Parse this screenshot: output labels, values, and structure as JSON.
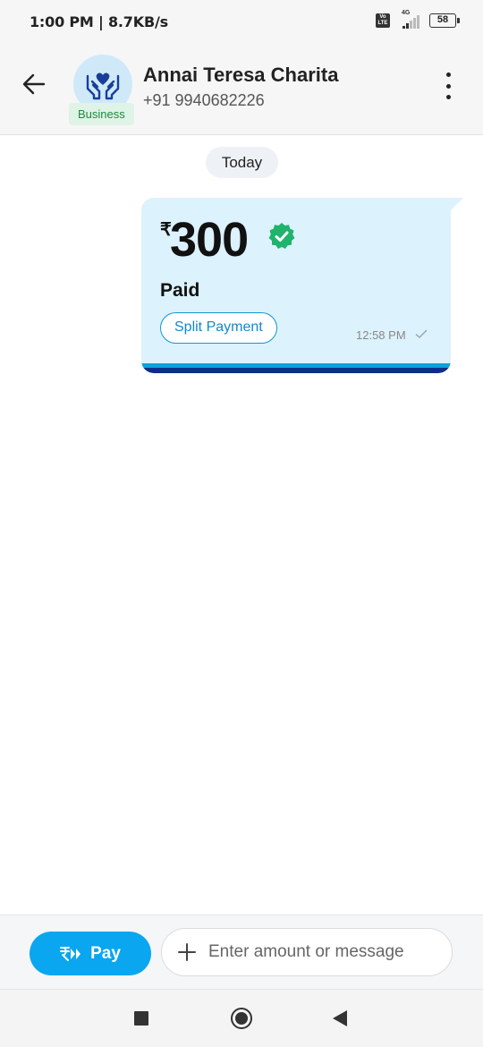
{
  "status_bar": {
    "time": "1:00 PM | 8.7KB/s",
    "volte": "Vo LTE",
    "network": "4G",
    "battery": "58"
  },
  "header": {
    "contact_name": "Annai Teresa Charita",
    "phone": "+91 9940682226",
    "badge": "Business",
    "icons": {
      "back": "arrow-left-icon",
      "avatar": "hands-heart-icon",
      "more": "more-vertical-icon"
    }
  },
  "chat": {
    "date_chip": "Today",
    "payment": {
      "currency_symbol": "₹",
      "amount": "300",
      "status": "Paid",
      "split_label": "Split Payment",
      "time": "12:58 PM",
      "icons": {
        "verified": "verified-check-icon",
        "sent": "check-icon"
      }
    }
  },
  "compose": {
    "pay_label": "Pay",
    "placeholder": "Enter amount or message",
    "icons": {
      "pay": "rupee-arrows-icon",
      "add": "plus-icon"
    }
  },
  "colors": {
    "accent": "#0aa6f0",
    "bubble_bg": "#dcf2fc",
    "verified_green": "#1fb36b",
    "badge_green": "#1c8a3e"
  }
}
